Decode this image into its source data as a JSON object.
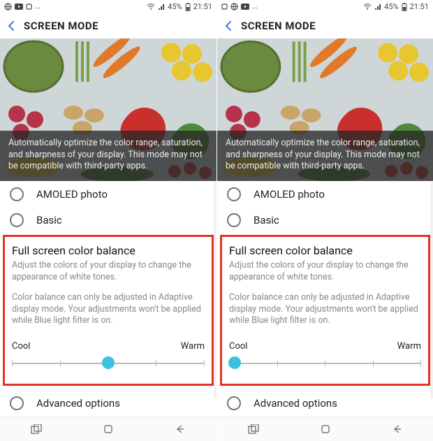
{
  "status": {
    "battery_pct": "45%",
    "time": "21:51"
  },
  "header": {
    "title": "SCREEN MODE"
  },
  "hero": {
    "overlay_text": "Automatically optimize the color range, saturation, and sharpness of your display. This mode may not be compatible with third-party apps."
  },
  "options": {
    "amoled": "AMOLED photo",
    "basic": "Basic",
    "advanced": "Advanced options"
  },
  "color_balance": {
    "title": "Full screen color balance",
    "subtitle": "Adjust the colors of your display to change the appearance of white tones.",
    "note": "Color balance can only be adjusted in Adaptive display mode. Your adjustments won't be applied while Blue light filter is on.",
    "cool_label": "Cool",
    "warm_label": "Warm"
  },
  "panels": {
    "left": {
      "slider_percent": 50
    },
    "right": {
      "slider_percent": 3
    }
  }
}
